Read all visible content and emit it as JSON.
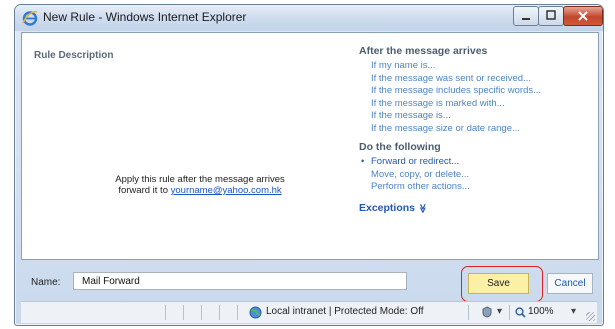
{
  "window": {
    "title": "New Rule - Windows Internet Explorer",
    "icons": {
      "app": "internet-explorer-icon",
      "minimize": "minimize-icon",
      "maximize": "maximize-icon",
      "close": "close-icon"
    }
  },
  "rule_description": {
    "label": "Rule Description",
    "line1": "Apply this rule after the message arrives",
    "line2_prefix": "forward it to",
    "email_link": "yourname@yahoo.com.hk"
  },
  "conditions": {
    "heading": "After the message arrives",
    "items": [
      "If my name is...",
      "If the message was sent or received...",
      "If the message includes specific words...",
      "If the message is marked with...",
      "If the message is...",
      "If the message size or date range..."
    ]
  },
  "actions": {
    "heading": "Do the following",
    "bullet": "•",
    "items": [
      "Forward or redirect...",
      "Move, copy, or delete...",
      "Perform other actions..."
    ],
    "selected_index": 0
  },
  "exceptions": {
    "label": "Exceptions",
    "icon": "double-chevron-down-icon",
    "glyph": "≫"
  },
  "form": {
    "name_label": "Name:",
    "name_value": "Mail Forward",
    "save_label": "Save",
    "cancel_label": "Cancel"
  },
  "statusbar": {
    "zone": "Local intranet | Protected Mode: Off",
    "zoom": "100%",
    "zone_icon": "globe-icon",
    "security_icon": "security-settings-icon",
    "zoom_icon": "magnifier-icon",
    "dropdown_glyph": "▾"
  },
  "colors": {
    "link": "#4f84c4",
    "save_bg": "#fbf0a5",
    "highlight_ring": "#e02020",
    "close_button": "#c2472c"
  }
}
